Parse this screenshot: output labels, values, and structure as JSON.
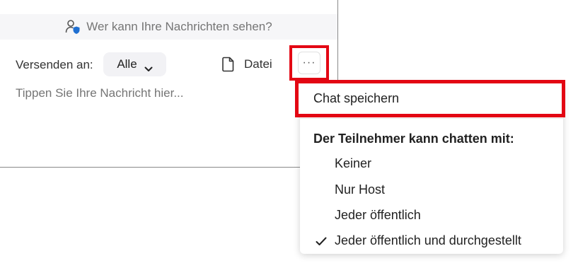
{
  "chat": {
    "privacy_notice": "Wer kann Ihre Nachrichten sehen?",
    "send_to_label": "Versenden an:",
    "recipient_value": "Alle",
    "file_label": "Datei",
    "more_label": "···",
    "message_placeholder": "Tippen Sie Ihre Nachricht hier..."
  },
  "menu": {
    "save_chat_label": "Chat speichern",
    "heading": "Der Teilnehmer kann chatten mit:",
    "options": [
      {
        "label": "Keiner",
        "checked": false
      },
      {
        "label": "Nur Host",
        "checked": false
      },
      {
        "label": "Jeder öffentlich",
        "checked": false
      },
      {
        "label": "Jeder öffentlich und durchgestellt",
        "checked": true
      }
    ]
  },
  "colors": {
    "highlight": "#e30613",
    "shield_accent": "#1f6fd1"
  },
  "icons": {
    "privacy": "shield-user-icon",
    "recipient_dropdown": "chevron-down-icon",
    "file": "document-icon",
    "more": "ellipsis-icon",
    "selected": "checkmark-icon"
  }
}
